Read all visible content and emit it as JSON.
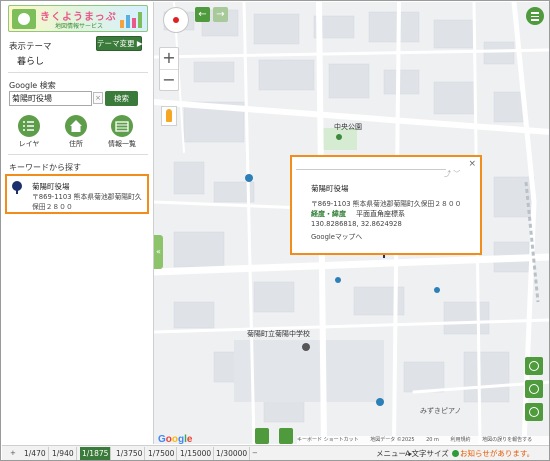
{
  "sidebar": {
    "logo_title": "きくようまっぷ",
    "logo_subtitle": "地図情報サービス",
    "theme_label": "表示テーマ",
    "theme_change_button": "テーマ変更 ▶",
    "theme_value": "暮らし",
    "search_label": "Google 検索",
    "search_value": "菊陽町役場",
    "search_clear": "×",
    "search_button": "検索",
    "tools": [
      {
        "label": "レイヤ",
        "icon": "layer-list-icon"
      },
      {
        "label": "住所",
        "icon": "house-icon"
      },
      {
        "label": "情報一覧",
        "icon": "list-icon"
      }
    ],
    "keyword_label": "キーワードから探す",
    "result": {
      "name": "菊陽町役場",
      "address": "〒869-1103 熊本県菊池郡菊陽町久保田２８００"
    },
    "collapse_icon": "«"
  },
  "map": {
    "zoom_in": "+",
    "zoom_out": "−",
    "nav_back": "←",
    "nav_forward": "→",
    "park_label": "中央公園",
    "school_label": "菊陽町立菊陽中学校",
    "shop_label": "みずきピアノ",
    "popup": {
      "close": "×",
      "share": "⤴︎ ﹀",
      "name": "菊陽町役場",
      "address": "〒869-1103 熊本県菊池郡菊陽町久保田２８００",
      "coord_label": "経度・緯度",
      "coord_system": "平面直角座標系",
      "coords": "130.8286818, 32.8624928",
      "google_maps_link": "Googleマップへ"
    },
    "google_logo": [
      "G",
      "o",
      "o",
      "g",
      "l",
      "e"
    ],
    "google_colors": [
      "#4285F4",
      "#EA4335",
      "#FBBC05",
      "#4285F4",
      "#34A853",
      "#EA4335"
    ],
    "attribution": [
      "キーボード ショートカット",
      "地図データ ©2025",
      "20 m",
      "利用規約",
      "地図の誤りを報告する"
    ]
  },
  "bottombar": {
    "scale_prefix": "+",
    "scales": [
      "1/470",
      "1/940",
      "1/1875",
      "1/3750",
      "1/7500",
      "1/15000",
      "1/30000"
    ],
    "active_scale": "1/1875",
    "scale_suffix": "−",
    "menu": "メニュー ▸",
    "fontsize": "Ａ文字サイズ",
    "notice": "お知らせがあります。"
  },
  "colors": {
    "brand_green": "#3a7a3a",
    "highlight_orange": "#f28c1b",
    "notice_orange": "#e65a00"
  }
}
